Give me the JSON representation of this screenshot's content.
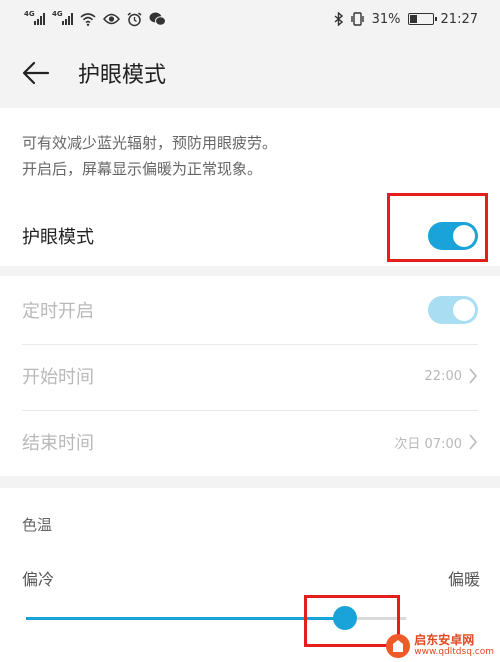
{
  "status_bar": {
    "sim1_label": "4G",
    "sim2_label": "4G",
    "icons": [
      "signal-icon",
      "wifi-icon",
      "eye-icon",
      "alarm-icon",
      "wechat-icon",
      "bluetooth-icon",
      "vibrate-icon",
      "battery-icon"
    ],
    "battery": "31%",
    "battery_level": 0.31,
    "time": "21:27"
  },
  "header": {
    "title": "护眼模式"
  },
  "eye_comfort": {
    "description_line1": "可有效减少蓝光辐射，预防用眼疲劳。",
    "description_line2": "开启后，屏幕显示偏暖为正常现象。",
    "label": "护眼模式",
    "enabled": true
  },
  "schedule": {
    "label": "定时开启",
    "enabled": true,
    "start_label": "开始时间",
    "start_value": "22:00",
    "end_label": "结束时间",
    "end_value": "次日 07:00"
  },
  "color_temp": {
    "title": "色温",
    "cool_label": "偏冷",
    "warm_label": "偏暖",
    "level": 0.82
  },
  "watermark": {
    "title": "启东安卓网",
    "url": "www.qdltdsq.com"
  },
  "colors": {
    "accent": "#1aa3d9",
    "accent_disabled": "#a9ddf2",
    "highlight": "#e41d1d",
    "background": "#f3f3f3"
  }
}
